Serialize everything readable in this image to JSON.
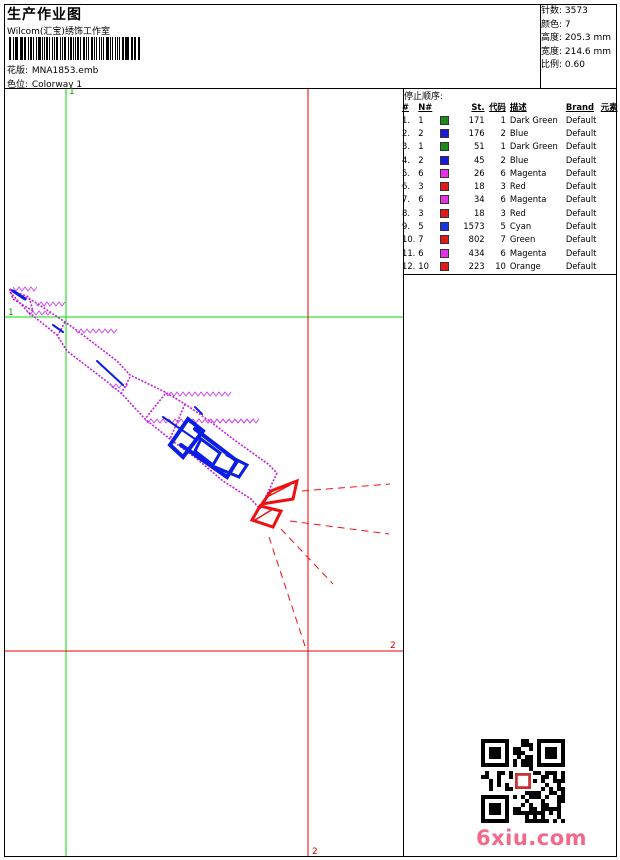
{
  "header": {
    "title": "生产作业图",
    "subtitle": "Wilcom(汇宝)绣饰工作室",
    "design_label": "花版:",
    "design_value": "MNA1853.emb",
    "colorway_label": "色位:",
    "colorway_value": "Colorway 1"
  },
  "stats": {
    "stitches": "针数: 3573",
    "colors": "颜色: 7",
    "height": "高度: 205.3 mm",
    "width": "宽度: 214.6 mm",
    "scale": "比例: 0.60"
  },
  "stop_sequence": {
    "title": "停止顺序:",
    "headers": [
      "#",
      "N#",
      "St.",
      "代码",
      "描述",
      "Brand",
      "元素"
    ],
    "rows": [
      {
        "no": "1.",
        "n": "1",
        "color": "#1a8a1a",
        "st": "171",
        "code": "1",
        "desc": "Dark Green",
        "brand": "Default"
      },
      {
        "no": "2.",
        "n": "2",
        "color": "#1a1ad6",
        "st": "176",
        "code": "2",
        "desc": "Blue",
        "brand": "Default"
      },
      {
        "no": "3.",
        "n": "1",
        "color": "#1a8a1a",
        "st": "51",
        "code": "1",
        "desc": "Dark Green",
        "brand": "Default"
      },
      {
        "no": "4.",
        "n": "2",
        "color": "#1a1ad6",
        "st": "45",
        "code": "2",
        "desc": "Blue",
        "brand": "Default"
      },
      {
        "no": "5.",
        "n": "6",
        "color": "#e632e6",
        "st": "26",
        "code": "6",
        "desc": "Magenta",
        "brand": "Default"
      },
      {
        "no": "6.",
        "n": "3",
        "color": "#e01a1a",
        "st": "18",
        "code": "3",
        "desc": "Red",
        "brand": "Default"
      },
      {
        "no": "7.",
        "n": "6",
        "color": "#e632e6",
        "st": "34",
        "code": "6",
        "desc": "Magenta",
        "brand": "Default"
      },
      {
        "no": "8.",
        "n": "3",
        "color": "#e01a1a",
        "st": "18",
        "code": "3",
        "desc": "Red",
        "brand": "Default"
      },
      {
        "no": "9.",
        "n": "5",
        "color": "#1a32e6",
        "st": "1573",
        "code": "5",
        "desc": "Cyan",
        "brand": "Default"
      },
      {
        "no": "10.",
        "n": "7",
        "color": "#e01a1a",
        "st": "802",
        "code": "7",
        "desc": "Green",
        "brand": "Default"
      },
      {
        "no": "11.",
        "n": "6",
        "color": "#e632e6",
        "st": "434",
        "code": "6",
        "desc": "Magenta",
        "brand": "Default"
      },
      {
        "no": "12.",
        "n": "10",
        "color": "#e01a1a",
        "st": "223",
        "code": "10",
        "desc": "Orange",
        "brand": "Default"
      }
    ]
  },
  "canvas": {
    "marker_top": "1",
    "marker_left": "1",
    "marker_right": "2",
    "marker_bottom": "2"
  },
  "watermark": {
    "brand": "6xiu.com"
  }
}
